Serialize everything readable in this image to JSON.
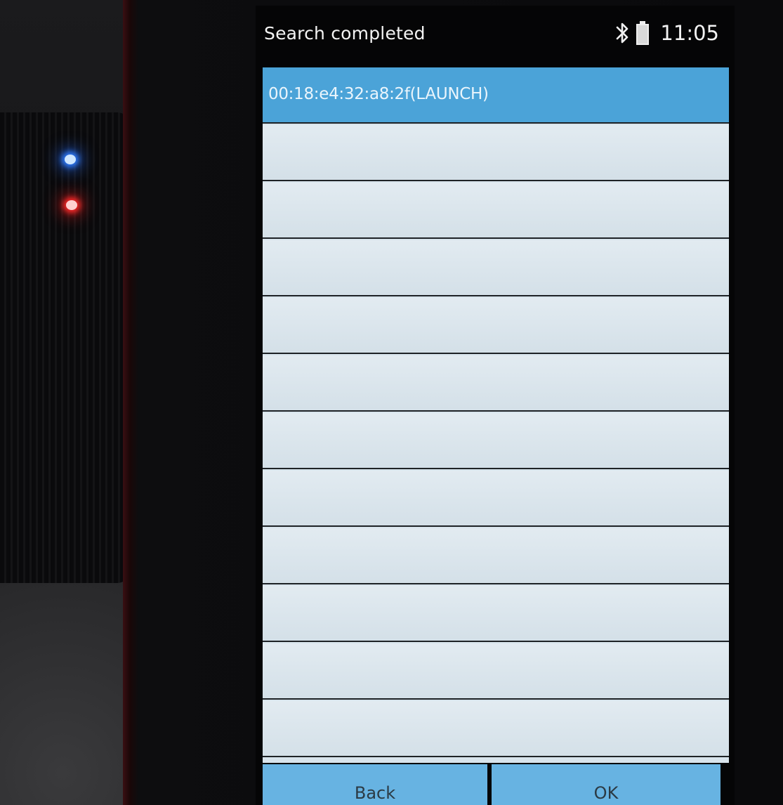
{
  "status_bar": {
    "title": "Search completed",
    "time": "11:05"
  },
  "device_list": {
    "items": [
      {
        "label": "00:18:e4:32:a8:2f(LAUNCH)",
        "selected": true
      },
      {
        "label": "",
        "selected": false
      },
      {
        "label": "",
        "selected": false
      },
      {
        "label": "",
        "selected": false
      },
      {
        "label": "",
        "selected": false
      },
      {
        "label": "",
        "selected": false
      },
      {
        "label": "",
        "selected": false
      },
      {
        "label": "",
        "selected": false
      },
      {
        "label": "",
        "selected": false
      },
      {
        "label": "",
        "selected": false
      },
      {
        "label": "",
        "selected": false
      },
      {
        "label": "",
        "selected": false
      }
    ]
  },
  "buttons": {
    "back_label": "Back",
    "ok_label": "OK"
  },
  "colors": {
    "selected_row": "#4ba3d8",
    "list_background": "#d8e4ec",
    "button_background": "#67b3e2"
  },
  "icons": {
    "bluetooth": "bluetooth-icon",
    "battery": "battery-icon"
  }
}
